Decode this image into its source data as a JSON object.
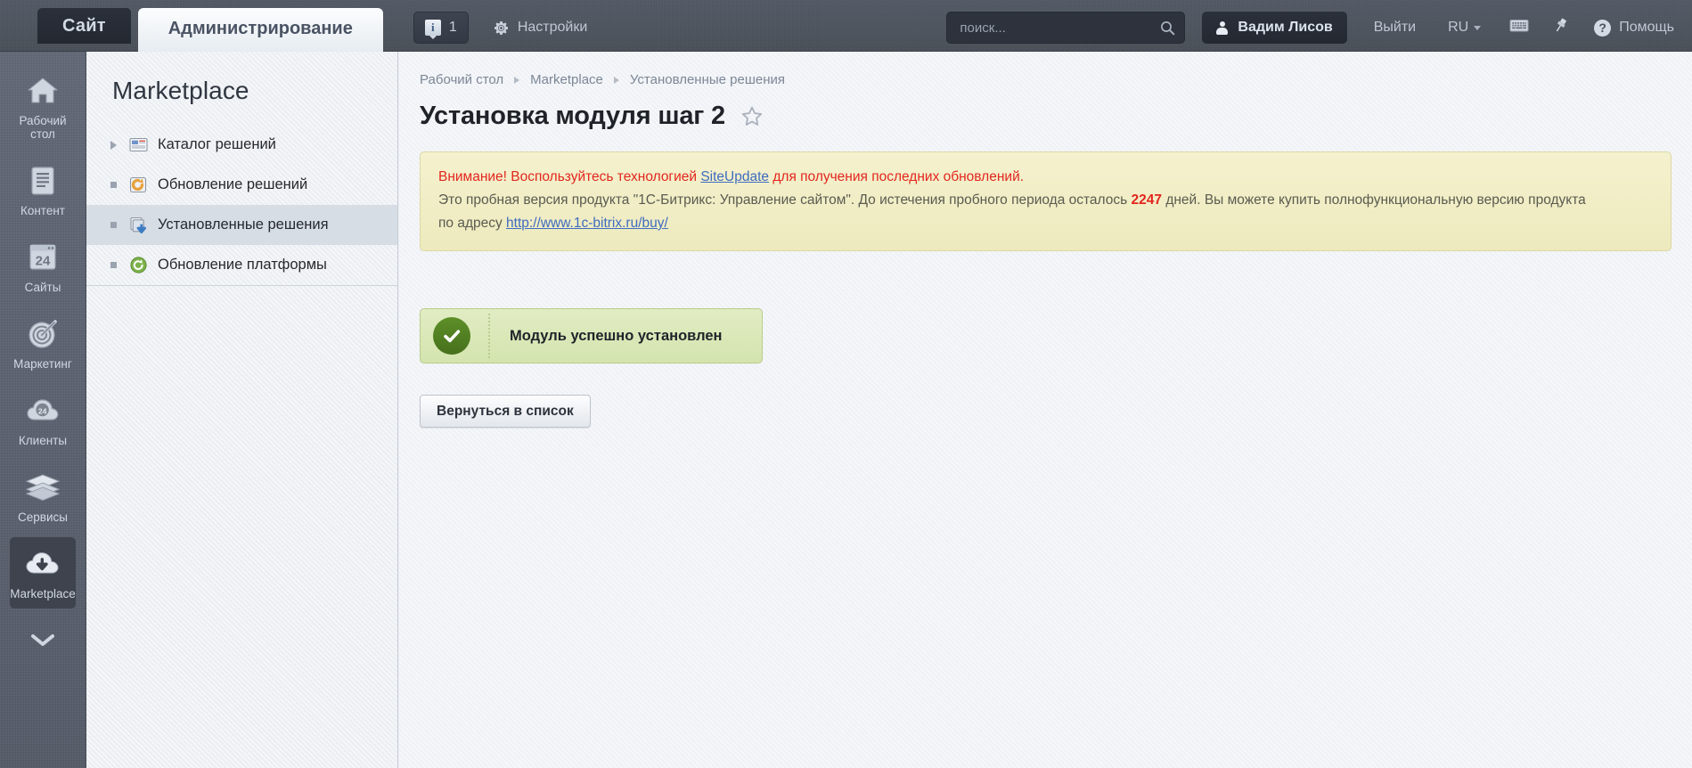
{
  "header": {
    "tab_site": "Сайт",
    "tab_admin": "Администрирование",
    "notifications_count": "1",
    "settings_label": "Настройки",
    "search_placeholder": "поиск...",
    "search_value": "",
    "user_name": "Вадим Лисов",
    "logout_label": "Выйти",
    "language": "RU",
    "help_label": "Помощь",
    "icons": {
      "info": "info-icon",
      "gear": "gear-icon",
      "search": "search-icon",
      "person": "person-icon",
      "keyboard": "keyboard-icon",
      "pin": "pin-icon",
      "help": "question-mark-icon"
    }
  },
  "rail": {
    "items": [
      {
        "label": "Рабочий\nстол",
        "label_line1": "Рабочий",
        "label_line2": "стол",
        "icon": "home-icon",
        "active": false
      },
      {
        "label": "Контент",
        "icon": "document-icon",
        "active": false
      },
      {
        "label": "Сайты",
        "icon": "window-24-icon",
        "active": false
      },
      {
        "label": "Маркетинг",
        "icon": "target-icon",
        "active": false
      },
      {
        "label": "Клиенты",
        "icon": "cloud-24-icon",
        "active": false
      },
      {
        "label": "Сервисы",
        "icon": "layers-icon",
        "active": false
      },
      {
        "label": "Marketplace",
        "icon": "cloud-download-icon",
        "active": true
      }
    ]
  },
  "menu_panel": {
    "title": "Marketplace",
    "items": [
      {
        "label": "Каталог решений",
        "marker": "triangle",
        "icon": "catalog-icon",
        "active": false
      },
      {
        "label": "Обновление решений",
        "marker": "square",
        "icon": "update-icon",
        "active": false
      },
      {
        "label": "Установленные решения",
        "marker": "square",
        "icon": "installed-icon",
        "active": true
      },
      {
        "label": "Обновление платформы",
        "marker": "square",
        "icon": "platform-update-icon",
        "active": false
      }
    ]
  },
  "main": {
    "breadcrumb": [
      {
        "label": "Рабочий стол"
      },
      {
        "label": "Marketplace"
      },
      {
        "label": "Установленные решения"
      }
    ],
    "page_title": "Установка модуля шаг 2",
    "favorite_icon": "star-icon",
    "warning": {
      "line1_a": "Внимание! Воспользуйтесь технологией ",
      "line1_link": "SiteUpdate",
      "line1_b": " для получения последних обновлений.",
      "line2_a": "Это пробная версия продукта \"1С-Битрикс: Управление сайтом\". До истечения пробного периода осталось ",
      "line2_days": "2247",
      "line2_b": " дней. Вы можете купить полнофункциональную версию продукта",
      "line3_a": "по адресу ",
      "line3_link": "http://www.1c-bitrix.ru/buy/"
    },
    "success": {
      "message": "Модуль успешно установлен",
      "icon": "check-circle-icon"
    },
    "back_button": "Вернуться в список"
  },
  "colors": {
    "accent_link": "#3f6cc0",
    "warning_red": "#e3261e",
    "success_green": "#5d8f28",
    "header_bg": "#4c525e",
    "rail_bg": "#5d6371"
  }
}
